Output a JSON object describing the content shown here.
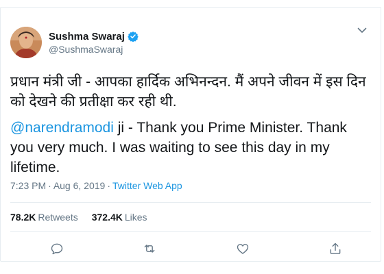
{
  "author": {
    "name": "Sushma Swaraj",
    "handle": "@SushmaSwaraj",
    "verified_icon": "verified-badge-icon"
  },
  "tweet": {
    "hindi_text": "प्रधान मंत्री जी - आपका हार्दिक अभिनन्दन. मैं अपने जीवन में इस दिन को देखने की प्रतीक्षा कर रही थी.",
    "mention": "@narendramodi",
    "english_text": " ji - Thank you Prime Minister. Thank you very much. I was waiting to see this day in my lifetime."
  },
  "meta": {
    "time": "7:23 PM",
    "separator": "·",
    "date": "Aug 6, 2019",
    "source": "Twitter Web App"
  },
  "stats": {
    "retweets_count": "78.2K",
    "retweets_label": "Retweets",
    "likes_count": "372.4K",
    "likes_label": "Likes"
  },
  "actions": [
    "reply-icon",
    "retweet-icon",
    "like-icon",
    "share-icon"
  ],
  "colors": {
    "link": "#1b95e0",
    "muted": "#657786",
    "text": "#14171a",
    "border": "#e6ecf0"
  }
}
